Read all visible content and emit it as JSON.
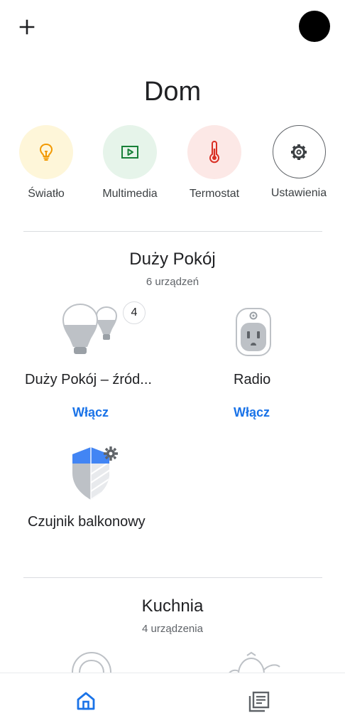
{
  "page_title": "Dom",
  "quick_actions": [
    {
      "label": "Światło",
      "icon": "lightbulb-icon",
      "bg": "#FEF6D9",
      "color": "#F29900"
    },
    {
      "label": "Multimedia",
      "icon": "play-icon",
      "bg": "#E6F4EA",
      "color": "#188038"
    },
    {
      "label": "Termostat",
      "icon": "thermometer-icon",
      "bg": "#FCE8E6",
      "color": "#D93025"
    },
    {
      "label": "Ustawienia",
      "icon": "gear-icon",
      "bg": "#FFFFFF",
      "color": "#5F6368"
    }
  ],
  "rooms": [
    {
      "name": "Duży Pokój",
      "count": "6 urządzeń",
      "devices": [
        {
          "name": "Duży Pokój – źród...",
          "action": "Włącz",
          "badge": "4",
          "icon": "light-group-icon"
        },
        {
          "name": "Radio",
          "action": "Włącz",
          "icon": "smart-plug-icon"
        },
        {
          "name": "Czujnik balkonowy",
          "icon": "security-sensor-icon"
        }
      ]
    },
    {
      "name": "Kuchnia",
      "count": "4 urządzenia"
    }
  ],
  "colors": {
    "accent": "#1A73E8",
    "divider": "#DADCE0"
  },
  "bottom_nav": [
    {
      "name": "home",
      "icon": "home-icon",
      "active": true
    },
    {
      "name": "feed",
      "icon": "feed-icon",
      "active": false
    }
  ]
}
